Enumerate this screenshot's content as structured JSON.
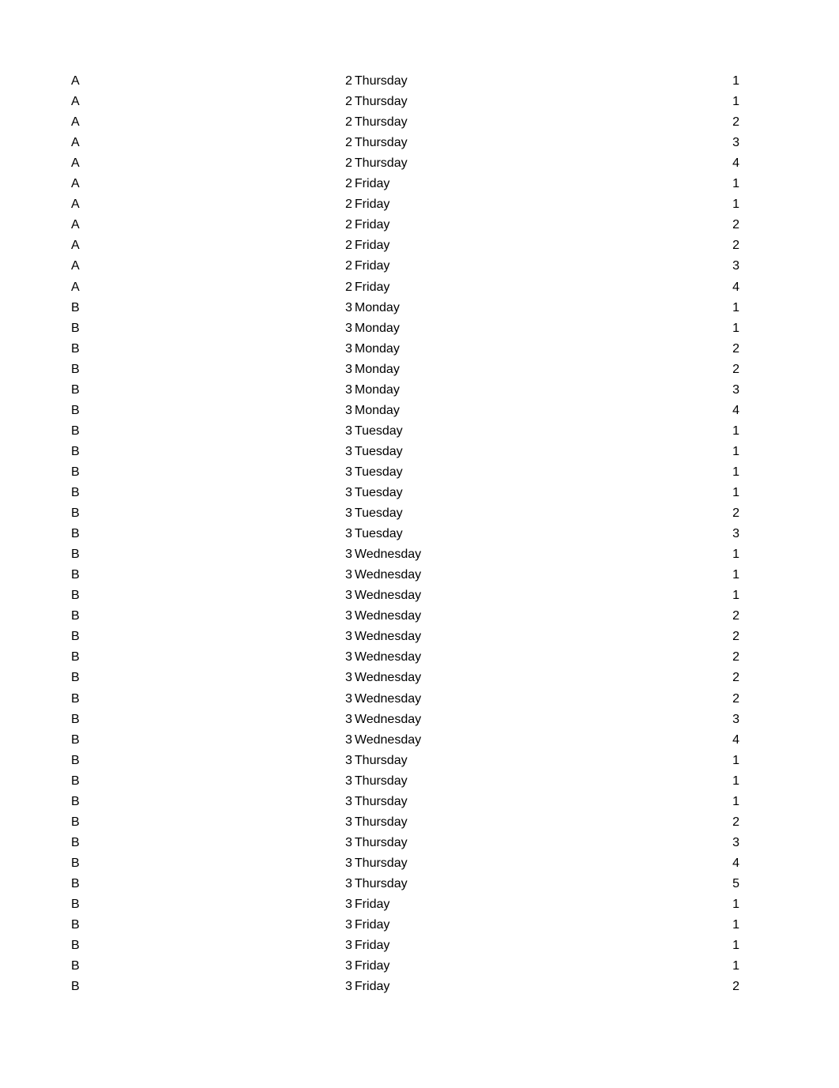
{
  "rows": [
    {
      "group": "A",
      "num": "2",
      "day": "Thursday",
      "value": "1"
    },
    {
      "group": "A",
      "num": "2",
      "day": "Thursday",
      "value": "1"
    },
    {
      "group": "A",
      "num": "2",
      "day": "Thursday",
      "value": "2"
    },
    {
      "group": "A",
      "num": "2",
      "day": "Thursday",
      "value": "3"
    },
    {
      "group": "A",
      "num": "2",
      "day": "Thursday",
      "value": "4"
    },
    {
      "group": "A",
      "num": "2",
      "day": "Friday",
      "value": "1"
    },
    {
      "group": "A",
      "num": "2",
      "day": "Friday",
      "value": "1"
    },
    {
      "group": "A",
      "num": "2",
      "day": "Friday",
      "value": "2"
    },
    {
      "group": "A",
      "num": "2",
      "day": "Friday",
      "value": "2"
    },
    {
      "group": "A",
      "num": "2",
      "day": "Friday",
      "value": "3"
    },
    {
      "group": "A",
      "num": "2",
      "day": "Friday",
      "value": "4"
    },
    {
      "group": "B",
      "num": "3",
      "day": "Monday",
      "value": "1"
    },
    {
      "group": "B",
      "num": "3",
      "day": "Monday",
      "value": "1"
    },
    {
      "group": "B",
      "num": "3",
      "day": "Monday",
      "value": "2"
    },
    {
      "group": "B",
      "num": "3",
      "day": "Monday",
      "value": "2"
    },
    {
      "group": "B",
      "num": "3",
      "day": "Monday",
      "value": "3"
    },
    {
      "group": "B",
      "num": "3",
      "day": "Monday",
      "value": "4"
    },
    {
      "group": "B",
      "num": "3",
      "day": "Tuesday",
      "value": "1"
    },
    {
      "group": "B",
      "num": "3",
      "day": "Tuesday",
      "value": "1"
    },
    {
      "group": "B",
      "num": "3",
      "day": "Tuesday",
      "value": "1"
    },
    {
      "group": "B",
      "num": "3",
      "day": "Tuesday",
      "value": "1"
    },
    {
      "group": "B",
      "num": "3",
      "day": "Tuesday",
      "value": "2"
    },
    {
      "group": "B",
      "num": "3",
      "day": "Tuesday",
      "value": "3"
    },
    {
      "group": "B",
      "num": "3",
      "day": "Wednesday",
      "value": "1"
    },
    {
      "group": "B",
      "num": "3",
      "day": "Wednesday",
      "value": "1"
    },
    {
      "group": "B",
      "num": "3",
      "day": "Wednesday",
      "value": "1"
    },
    {
      "group": "B",
      "num": "3",
      "day": "Wednesday",
      "value": "2"
    },
    {
      "group": "B",
      "num": "3",
      "day": "Wednesday",
      "value": "2"
    },
    {
      "group": "B",
      "num": "3",
      "day": "Wednesday",
      "value": "2"
    },
    {
      "group": "B",
      "num": "3",
      "day": "Wednesday",
      "value": "2"
    },
    {
      "group": "B",
      "num": "3",
      "day": "Wednesday",
      "value": "2"
    },
    {
      "group": "B",
      "num": "3",
      "day": "Wednesday",
      "value": "3"
    },
    {
      "group": "B",
      "num": "3",
      "day": "Wednesday",
      "value": "4"
    },
    {
      "group": "B",
      "num": "3",
      "day": "Thursday",
      "value": "1"
    },
    {
      "group": "B",
      "num": "3",
      "day": "Thursday",
      "value": "1"
    },
    {
      "group": "B",
      "num": "3",
      "day": "Thursday",
      "value": "1"
    },
    {
      "group": "B",
      "num": "3",
      "day": "Thursday",
      "value": "2"
    },
    {
      "group": "B",
      "num": "3",
      "day": "Thursday",
      "value": "3"
    },
    {
      "group": "B",
      "num": "3",
      "day": "Thursday",
      "value": "4"
    },
    {
      "group": "B",
      "num": "3",
      "day": "Thursday",
      "value": "5"
    },
    {
      "group": "B",
      "num": "3",
      "day": "Friday",
      "value": "1"
    },
    {
      "group": "B",
      "num": "3",
      "day": "Friday",
      "value": "1"
    },
    {
      "group": "B",
      "num": "3",
      "day": "Friday",
      "value": "1"
    },
    {
      "group": "B",
      "num": "3",
      "day": "Friday",
      "value": "1"
    },
    {
      "group": "B",
      "num": "3",
      "day": "Friday",
      "value": "2"
    }
  ]
}
